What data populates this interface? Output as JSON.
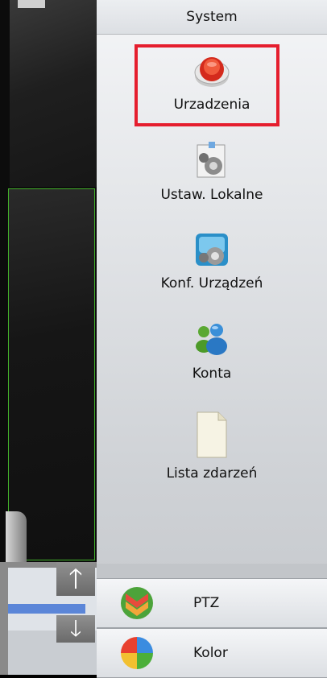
{
  "panel": {
    "title": "System",
    "items": [
      {
        "label": "Urzadzenia",
        "icon": "red-power-button-icon",
        "selected": true
      },
      {
        "label": "Ustaw. Lokalne",
        "icon": "local-settings-gear-icon"
      },
      {
        "label": "Konf. Urządzeń",
        "icon": "device-config-gear-icon"
      },
      {
        "label": "Konta",
        "icon": "users-accounts-icon"
      },
      {
        "label": "Lista zdarzeń",
        "icon": "event-list-document-icon"
      }
    ]
  },
  "bottom": {
    "ptz": {
      "label": "PTZ",
      "icon": "ptz-chevrons-icon"
    },
    "kolor": {
      "label": "Kolor",
      "icon": "color-palette-icon"
    }
  },
  "scroll": {
    "up_arrow": "🡑",
    "down_arrow": "🡓"
  },
  "colors": {
    "highlight": "#e51e2e",
    "accent": "#5b86d8",
    "video_border": "#43b02a"
  }
}
